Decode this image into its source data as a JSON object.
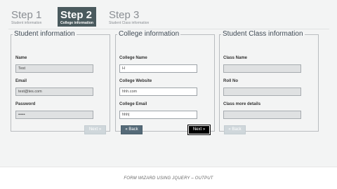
{
  "steps": [
    {
      "number": "Step 1",
      "subtitle": "Student information"
    },
    {
      "number": "Step 2",
      "subtitle": "College information"
    },
    {
      "number": "Step 3",
      "subtitle": "Student Class information"
    }
  ],
  "panels": {
    "student": {
      "legend": "Student information",
      "fields": [
        {
          "label": "Name",
          "value": "Test"
        },
        {
          "label": "Email",
          "value": "test@tes.com"
        },
        {
          "label": "Password",
          "value": "•••••"
        }
      ],
      "next_label": "Next »"
    },
    "college": {
      "legend": "College information",
      "fields": [
        {
          "label": "College Name",
          "value": "H"
        },
        {
          "label": "College Website",
          "value": "hhh.com"
        },
        {
          "label": "College Email",
          "value": "hhh|"
        }
      ],
      "back_label": "« Back",
      "next_label": "Next »"
    },
    "class": {
      "legend": "Student Class information",
      "fields": [
        {
          "label": "Class Name",
          "value": ""
        },
        {
          "label": "Roll No",
          "value": ""
        },
        {
          "label": "Class more details",
          "value": ""
        }
      ],
      "back_label": "« Back"
    }
  },
  "caption": "FORM WIZARD USING JQUERY – OUTPUT",
  "colors": {
    "active_step_bg": "#4a5a5e",
    "back_button": "#556a78",
    "next_button": "#000000",
    "disabled_button": "#cfd7db"
  }
}
